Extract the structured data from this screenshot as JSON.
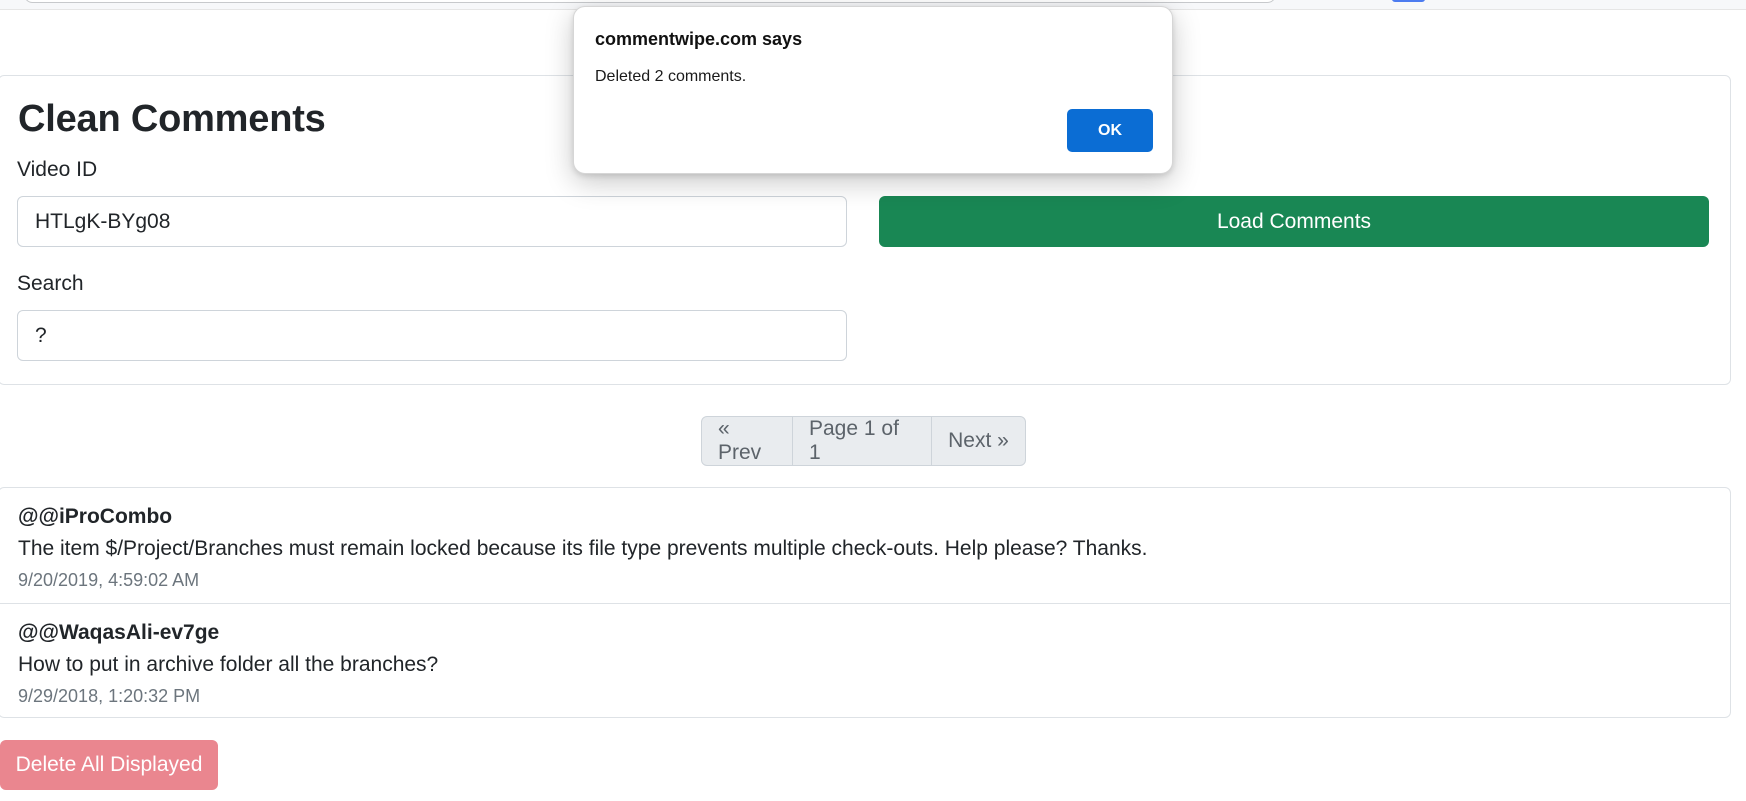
{
  "dialog": {
    "title": "commentwipe.com says",
    "message": "Deleted 2 comments.",
    "ok_label": "OK"
  },
  "form": {
    "title": "Clean Comments",
    "video_id_label": "Video ID",
    "video_id_value": "HTLgK-BYg08",
    "load_button_label": "Load Comments",
    "search_label": "Search",
    "search_value": "?"
  },
  "pagination": {
    "prev_label": "« Prev",
    "page_info": "Page 1 of 1",
    "next_label": "Next »"
  },
  "comments": [
    {
      "author": "@@iProCombo",
      "text": "The item $/Project/Branches must remain locked because its file type prevents multiple check-outs. Help please? Thanks.",
      "date": "9/20/2019, 4:59:02 AM"
    },
    {
      "author": "@@WaqasAli-ev7ge",
      "text": "How to put in archive folder all the branches?",
      "date": "9/29/2018, 1:20:32 PM"
    }
  ],
  "actions": {
    "delete_all_label": "Delete All Displayed"
  },
  "colors": {
    "load_button": "#198754",
    "delete_button": "#ea868f",
    "dialog_ok": "#0b6dd4"
  }
}
